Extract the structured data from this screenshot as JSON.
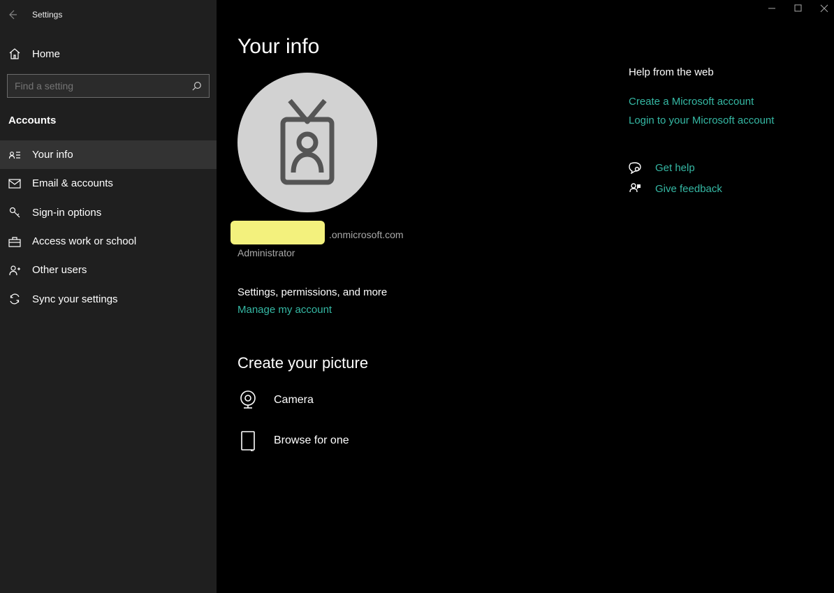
{
  "app_title": "Settings",
  "home_label": "Home",
  "search": {
    "placeholder": "Find a setting"
  },
  "section": "Accounts",
  "nav": [
    {
      "label": "Your info"
    },
    {
      "label": "Email & accounts"
    },
    {
      "label": "Sign-in options"
    },
    {
      "label": "Access work or school"
    },
    {
      "label": "Other users"
    },
    {
      "label": "Sync your settings"
    }
  ],
  "page": {
    "title": "Your info",
    "email_tail": ".onmicrosoft.com",
    "role": "Administrator",
    "settings_more": "Settings, permissions, and more",
    "manage_link": "Manage my account",
    "create_picture": "Create your picture",
    "camera": "Camera",
    "browse": "Browse for one"
  },
  "help": {
    "title": "Help from the web",
    "links": [
      "Create a Microsoft account",
      "Login to your Microsoft account"
    ],
    "get_help": "Get help",
    "feedback": "Give feedback"
  },
  "colors": {
    "accent": "#35b8a4"
  }
}
